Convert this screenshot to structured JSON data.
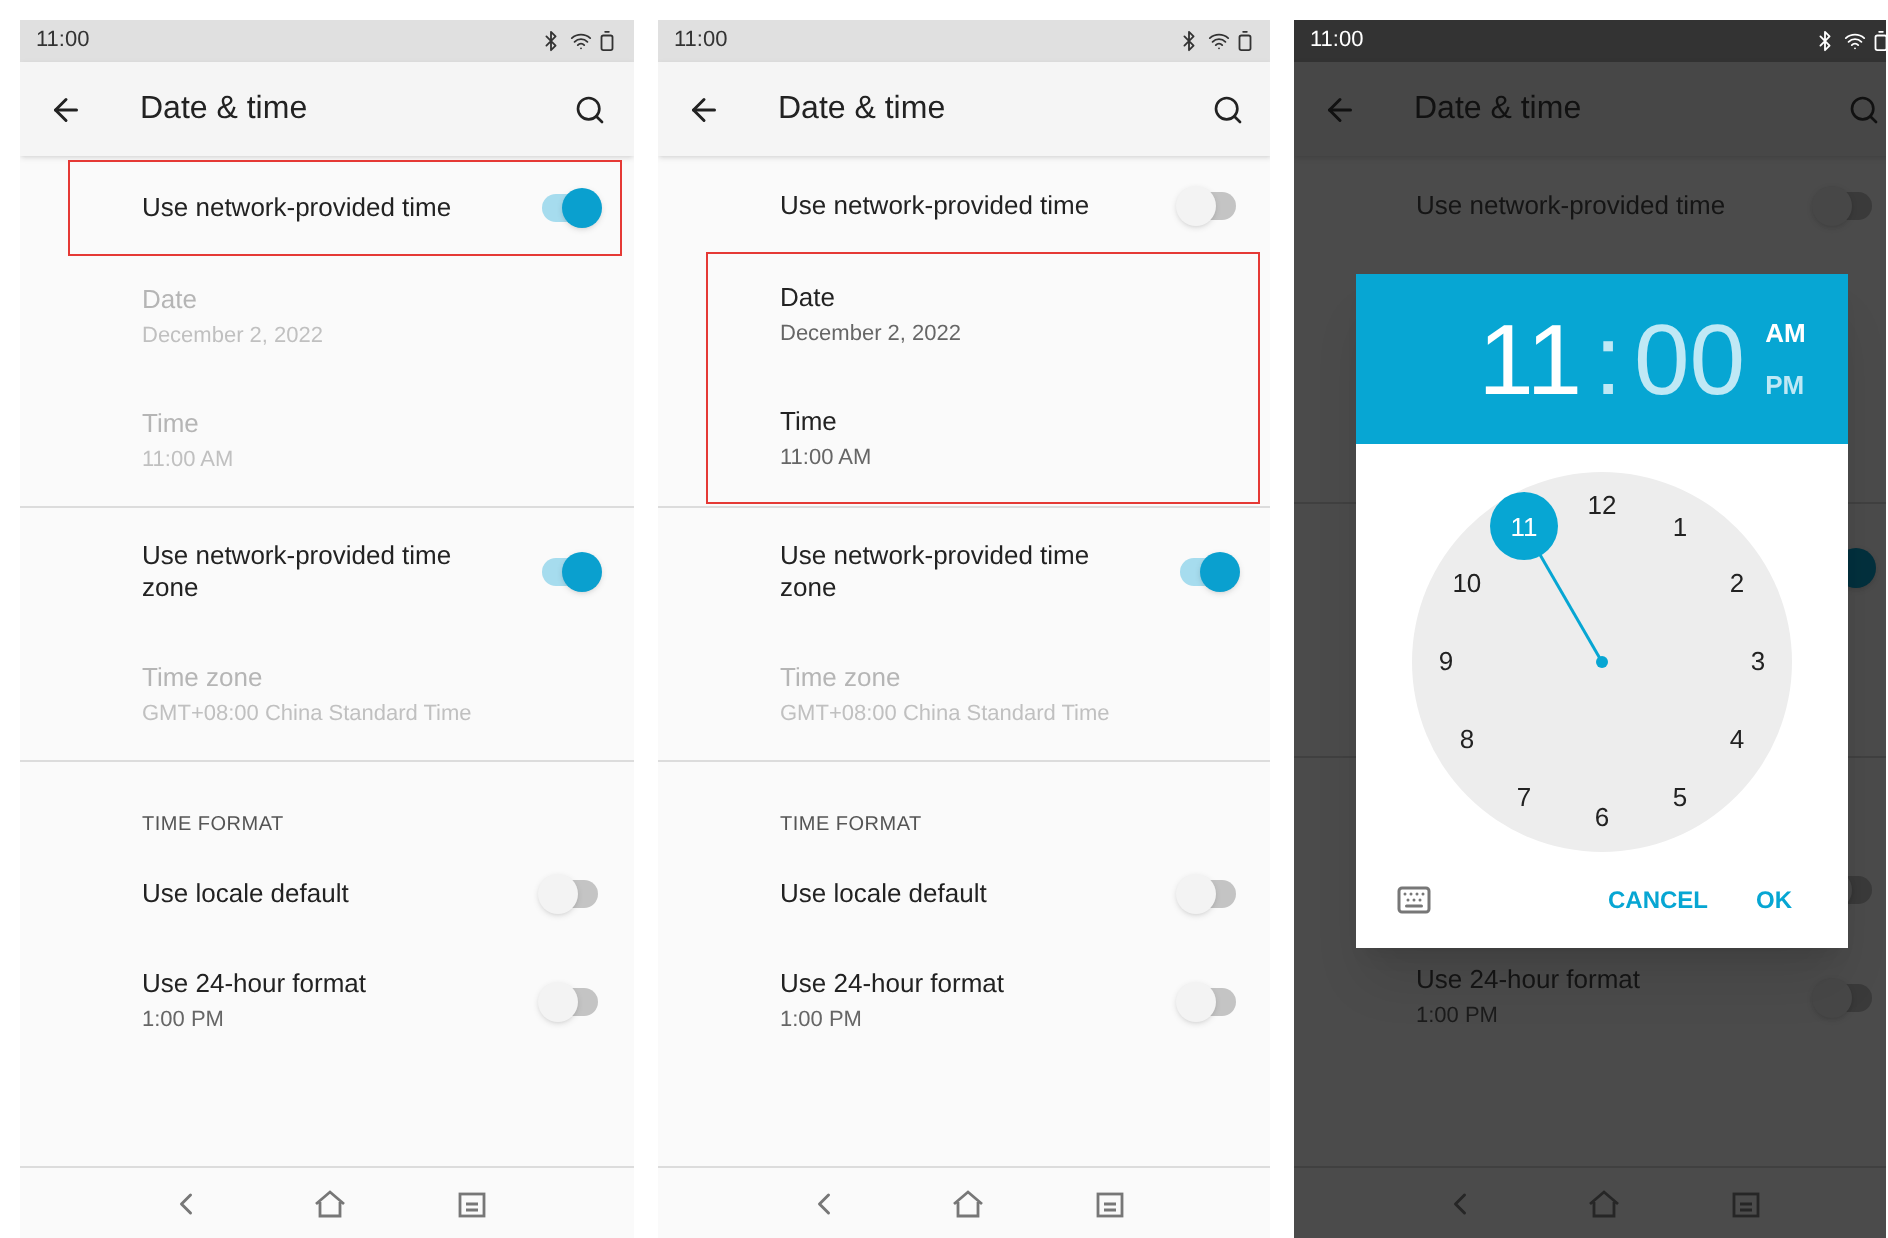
{
  "screens": [
    {
      "status_time": "11:00",
      "title": "Date & time",
      "dimmed": false,
      "items": [
        {
          "kind": "toggle",
          "title": "Use network-provided time",
          "on": true,
          "highlighted": true
        },
        {
          "kind": "info",
          "title": "Date",
          "subtitle": "December 2, 2022",
          "disabled": true,
          "highlighted": false
        },
        {
          "kind": "info",
          "title": "Time",
          "subtitle": "11:00 AM",
          "disabled": true,
          "highlighted": false
        },
        {
          "kind": "divider"
        },
        {
          "kind": "toggle_tall",
          "title": "Use network-provided time zone",
          "on": true,
          "highlighted": false
        },
        {
          "kind": "info",
          "title": "Time zone",
          "subtitle": "GMT+08:00 China Standard Time",
          "disabled": true,
          "highlighted": false
        },
        {
          "kind": "divider"
        },
        {
          "kind": "header",
          "title": "TIME FORMAT"
        },
        {
          "kind": "toggle",
          "title": "Use locale default",
          "on": false,
          "highlighted": false
        },
        {
          "kind": "toggle_tall",
          "title": "Use 24-hour format",
          "subtitle": "1:00 PM",
          "on": false,
          "highlighted": false
        }
      ]
    },
    {
      "status_time": "11:00",
      "title": "Date & time",
      "dimmed": false,
      "items": [
        {
          "kind": "toggle",
          "title": "Use network-provided time",
          "on": false,
          "highlighted": false
        },
        {
          "kind": "info",
          "title": "Date",
          "subtitle": "December 2, 2022",
          "disabled": false,
          "highlighted": true
        },
        {
          "kind": "info",
          "title": "Time",
          "subtitle": "11:00 AM",
          "disabled": false,
          "highlighted": true
        },
        {
          "kind": "divider"
        },
        {
          "kind": "toggle_tall",
          "title": "Use network-provided time zone",
          "on": true,
          "highlighted": false
        },
        {
          "kind": "info",
          "title": "Time zone",
          "subtitle": "GMT+08:00 China Standard Time",
          "disabled": true,
          "highlighted": false
        },
        {
          "kind": "divider"
        },
        {
          "kind": "header",
          "title": "TIME FORMAT"
        },
        {
          "kind": "toggle",
          "title": "Use locale default",
          "on": false,
          "highlighted": false
        },
        {
          "kind": "toggle_tall",
          "title": "Use 24-hour format",
          "subtitle": "1:00 PM",
          "on": false,
          "highlighted": false
        }
      ]
    },
    {
      "status_time": "11:00",
      "title": "Date & time",
      "dimmed": true,
      "items": [
        {
          "kind": "toggle",
          "title": "Use network-provided time",
          "on": false
        },
        {
          "kind": "info"
        },
        {
          "kind": "info"
        },
        {
          "kind": "divider"
        },
        {
          "kind": "toggle_tall",
          "on": true
        },
        {
          "kind": "info"
        },
        {
          "kind": "divider"
        },
        {
          "kind": "header"
        },
        {
          "kind": "toggle",
          "on": false
        },
        {
          "kind": "toggle_tall",
          "title": "Use 24-hour format",
          "subtitle": "1:00 PM",
          "on": false
        }
      ],
      "dialog": {
        "hour": "11",
        "separator": ":",
        "minute": "00",
        "periods": [
          {
            "label": "AM",
            "selected": true
          },
          {
            "label": "PM",
            "selected": false
          }
        ],
        "dial": [
          {
            "label": "12",
            "selected": false
          },
          {
            "label": "1",
            "selected": false
          },
          {
            "label": "2",
            "selected": false
          },
          {
            "label": "3",
            "selected": false
          },
          {
            "label": "4",
            "selected": false
          },
          {
            "label": "5",
            "selected": false
          },
          {
            "label": "6",
            "selected": false
          },
          {
            "label": "7",
            "selected": false
          },
          {
            "label": "8",
            "selected": false
          },
          {
            "label": "9",
            "selected": false
          },
          {
            "label": "10",
            "selected": false
          },
          {
            "label": "11",
            "selected": true
          }
        ],
        "buttons": [
          "CANCEL",
          "OK"
        ]
      }
    }
  ]
}
